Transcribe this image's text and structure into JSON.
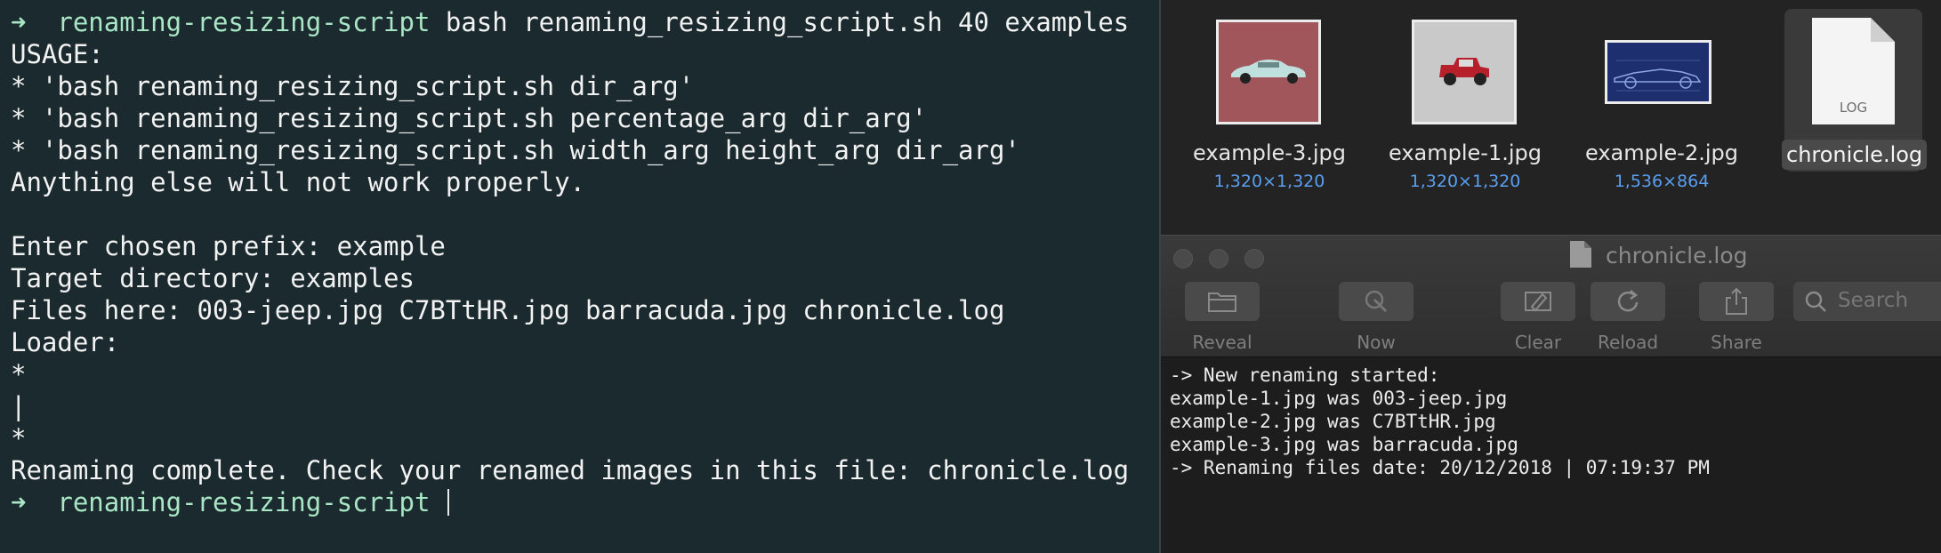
{
  "terminal": {
    "prompt_arrow": "➜",
    "prompt_dir": "renaming-resizing-script",
    "command": "bash renaming_resizing_script.sh 40 examples",
    "output": [
      "USAGE:",
      "* 'bash renaming_resizing_script.sh dir_arg'",
      "* 'bash renaming_resizing_script.sh percentage_arg dir_arg'",
      "* 'bash renaming_resizing_script.sh width_arg height_arg dir_arg'",
      "Anything else will not work properly.",
      "",
      "Enter chosen prefix: example",
      "Target directory: examples",
      "Files here: 003-jeep.jpg C7BTtHR.jpg barracuda.jpg chronicle.log",
      "Loader:",
      "*",
      "|",
      "*",
      "Renaming complete. Check your renamed images in this file: chronicle.log"
    ]
  },
  "finder": {
    "files": [
      {
        "name": "example-3.jpg",
        "dims": "1,320×1,320",
        "icon": "red-car-thumbnail"
      },
      {
        "name": "example-1.jpg",
        "dims": "1,320×1,320",
        "icon": "jeep-thumbnail"
      },
      {
        "name": "example-2.jpg",
        "dims": "1,536×864",
        "icon": "race-car-blueprint-thumbnail"
      },
      {
        "name": "chronicle.log",
        "dims": "",
        "icon": "log-document-icon",
        "icon_label": "LOG",
        "selected": true
      }
    ]
  },
  "console": {
    "title": "chronicle.log",
    "toolbar": [
      {
        "label": "Reveal",
        "icon": "folder-icon"
      },
      {
        "label": "Now",
        "icon": "now-icon"
      },
      {
        "label": "Clear",
        "icon": "clear-icon"
      },
      {
        "label": "Reload",
        "icon": "reload-icon"
      },
      {
        "label": "Share",
        "icon": "share-icon"
      }
    ],
    "search_placeholder": "Search",
    "log_lines": [
      "-> New renaming started:",
      "example-1.jpg was 003-jeep.jpg",
      "example-2.jpg was C7BTtHR.jpg",
      "example-3.jpg was barracuda.jpg",
      "-> Renaming files date: 20/12/2018 | 07:19:37 PM"
    ]
  },
  "colors": {
    "terminal_bg": "#1b2a2e",
    "prompt_green": "#a8e6c5",
    "finder_bg": "#232323",
    "dims_blue": "#5a9ff0"
  }
}
